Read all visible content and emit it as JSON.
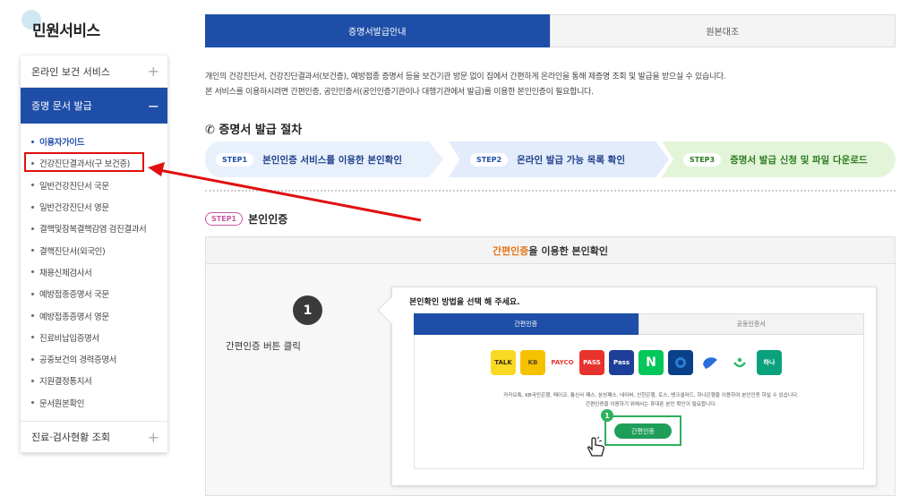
{
  "sidebar": {
    "title": "민원서비스",
    "groups": {
      "online_health": {
        "label": "온라인 보건 서비스",
        "icon": "+"
      },
      "cert_issue": {
        "label": "증명 문서 발급",
        "icon": "−"
      },
      "treatment": {
        "label": "진료·검사현황 조회",
        "icon": "+"
      }
    },
    "items": [
      "이용자가이드",
      "건강진단결과서(구 보건증)",
      "일반건강진단서 국문",
      "일반건강진단서 영문",
      "결핵및잠복결핵감염 검진결과서",
      "결핵진단서(외국인)",
      "채용신체검사서",
      "예방접종증명서 국문",
      "예방접종증명서 영문",
      "진료비납입증명서",
      "공중보건의 경력증명서",
      "지원결정통지서",
      "문서원본확인"
    ]
  },
  "tabs": {
    "active": "증명서발급안내",
    "inactive": "원본대조"
  },
  "intro": {
    "line1": "개인의 건강진단서, 건강진단결과서(보건증), 예방접종 증명서 등을 보건기관 방문 없이 집에서 간편하게 온라인을 통해 제증명 조회 및 발급을 받으실 수 있습니다.",
    "line2": "본 서비스를 이용하시려면 간편인증, 공인인증서(공인인증기관이나 대행기관에서 발급)를 이용한 본인인증이 필요합니다."
  },
  "procedure": {
    "title": "✆ 증명서 발급 절차",
    "steps": [
      {
        "tag": "STEP1",
        "label": "본인인증 서비스를 이용한 본인확인"
      },
      {
        "tag": "STEP2",
        "label": "온라인 발급 가능 목록 확인"
      },
      {
        "tag": "STEP3",
        "label": "증명서 발급 신청 및 파일 다운로드"
      }
    ]
  },
  "step1_section": {
    "tag": "STEP1",
    "title": "본인인증",
    "box_title_highlight": "간편인증",
    "box_title_rest": "을 이용한 본인확인",
    "step_number": "1",
    "instruction": "간편인증 버튼 클릭",
    "panel": {
      "title": "본인확인 방법을 선택 해 주세요.",
      "tabs": [
        "간편인증",
        "공동인증서"
      ],
      "providers": [
        "TALK",
        "KB",
        "PAYCO",
        "PASS",
        "Pass",
        "N",
        "신한",
        "toss",
        "bank",
        "하나"
      ],
      "notice_line1": "카카오톡, KB국민은행, 페이코, 통신사 패스, 삼성패스, 네이버, 신한은행, 토스, 뱅크샐러드, 하나은행을 이용하여 본인인증 하실 수 있습니다.",
      "notice_line2": "간편인증을 이용하기 위해서는 휴대폰 본인 확인이 필요합니다.",
      "button_num": "1",
      "button_label": "간편인증"
    }
  },
  "colors": {
    "primary": "#1e4ea8",
    "highlight_red": "#e01010",
    "green": "#2eb05c",
    "orange": "#e8751a"
  }
}
